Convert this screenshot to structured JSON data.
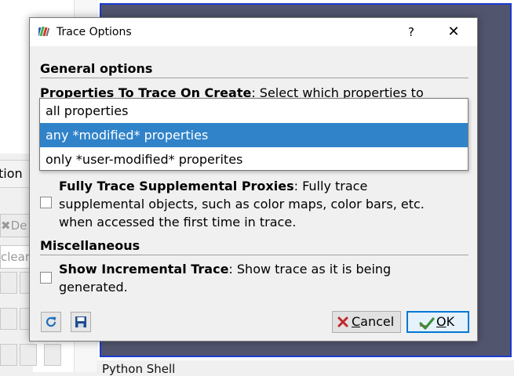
{
  "background": {
    "tab_partial": "tion",
    "delete_partial": "De",
    "clear_partial": "clear",
    "python_shell": "Python Shell"
  },
  "dialog": {
    "title": "Trace Options",
    "help_label": "?",
    "close_label": "✕",
    "general_heading": "General options",
    "properties_label": "Properties To Trace On Create",
    "properties_desc": ": Select which properties to",
    "dropdown": {
      "options": [
        "all properties",
        "any *modified* properties",
        "only *user-modified* properites"
      ],
      "selected_index": 1
    },
    "supplemental": {
      "label": "Fully Trace Supplemental Proxies",
      "desc_line1": ": Fully trace",
      "desc_line2": "supplemental objects, such as color maps, color bars, etc.",
      "desc_line3": "when accessed the first time in trace.",
      "checked": false
    },
    "misc_heading": "Miscellaneous",
    "incremental": {
      "label": "Show Incremental Trace",
      "desc_line1": ": Show trace as it is being",
      "desc_line2": "generated.",
      "checked": false
    },
    "buttons": {
      "cancel_prefix": "",
      "cancel_mnemonic": "C",
      "cancel_rest": "ancel",
      "ok_mnemonic": "O",
      "ok_rest": "K"
    }
  },
  "colors": {
    "selection": "#3083c9",
    "view_background": "#52556e",
    "view_border": "#1a3bd1",
    "ok_border": "#0078d7"
  }
}
